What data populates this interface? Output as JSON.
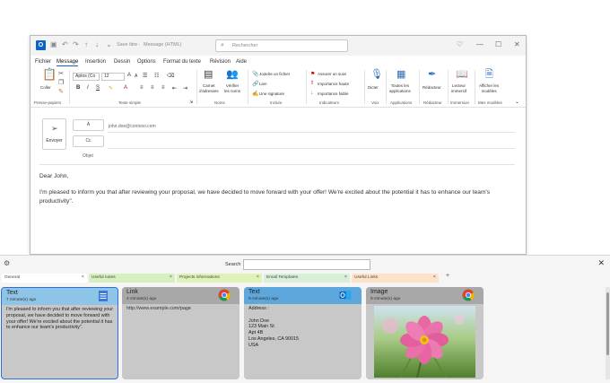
{
  "window": {
    "save_label": "Save titre",
    "doc_title": "Message (HTML)",
    "search_placeholder": "Rechercher"
  },
  "menu": [
    "Fichier",
    "Message",
    "Insertion",
    "Dessin",
    "Options",
    "Format du texte",
    "Révision",
    "Aide"
  ],
  "ribbon": {
    "paste": "Coller",
    "clipboard_group": "Presse-papiers",
    "font_name": "Aptos (Co",
    "font_size": "12",
    "text_group": "Texte simple",
    "address_book": "Carnet\nd'adresses",
    "check_names": "Vérifier\nles noms",
    "names_group": "Noms",
    "attach_file": "Joindre un fichier",
    "link": "Lien",
    "signature": "Une signature",
    "include_group": "Inclure",
    "follow_up": "Assurer un suivi",
    "high_importance": "Importance haute",
    "low_importance": "Importance faible",
    "tags_group": "Indicateurs",
    "dictate": "Dicter",
    "voice_group": "Voix",
    "all_apps": "Toutes les\napplications",
    "apps_group": "Applications",
    "editor": "Rédacteur",
    "editor_group": "Rédacteur",
    "immersive_reader": "Lecteur\nimmersif",
    "immersion_group": "Immersion",
    "view_templates": "Afficher les\nmodèles",
    "templates_group": "Mes modèles"
  },
  "compose": {
    "send": "Envoyer",
    "to_label": "À",
    "cc_label": "Cc",
    "subject_label": "Objet",
    "to_value": "john.doe@contoso.com",
    "greeting": "Dear John,",
    "body": "I'm pleased to inform you that after reviewing your proposal, we have decided to move forward with your offer! We're excited about the potential it has to enhance our team's productivity\"."
  },
  "clipboard": {
    "search_label": "Search",
    "search_value": "",
    "tabs": [
      {
        "label": "General",
        "color": "#ffffff"
      },
      {
        "label": "Useful notes",
        "color": "#d6f0c0"
      },
      {
        "label": "Projects informations",
        "color": "#dff3b8"
      },
      {
        "label": "Email Templates",
        "color": "#d8f0d8"
      },
      {
        "label": "Useful Links",
        "color": "#fde2c8"
      }
    ],
    "add_tab": "+",
    "cards": [
      {
        "type": "Text",
        "time": "7 minute(s) ago",
        "content": "I'm pleased to inform you that after reviewing your\nproposal, we have decided to move forward with\nyour offer! We're excited about the potential it has\nto enhance our team's productivity\".",
        "header_color": "#8ec5e6",
        "icon": "notepad-icon"
      },
      {
        "type": "Link",
        "time": "4 minute(s) ago",
        "content": "http://www.example.com/page",
        "header_color": "#a8a8a8",
        "icon": "chrome-icon"
      },
      {
        "type": "Text",
        "time": "9 minute(s) ago",
        "content": "Address :\n\nJohn Doe\n123 Main St\nApt 4B\nLos Angeles, CA 90015\nUSA",
        "header_color": "#5ea7dc",
        "icon": "outlook-icon"
      },
      {
        "type": "Image",
        "time": "9 minute(s) ago",
        "content": "",
        "header_color": "#a8a8a8",
        "icon": "chrome-icon"
      }
    ]
  }
}
